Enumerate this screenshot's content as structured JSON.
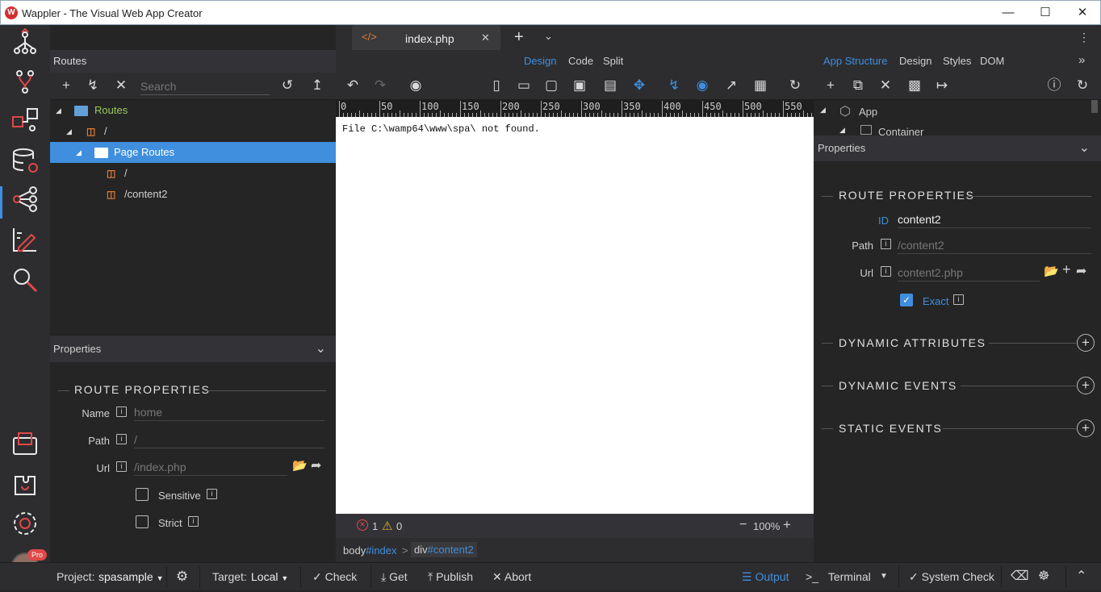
{
  "window": {
    "title": "Wappler - The Visual Web App Creator",
    "logo": "W"
  },
  "tab": {
    "file": "index.php"
  },
  "left": {
    "header": "Routes",
    "search_placeholder": "Search",
    "tree": [
      {
        "label": "Routes",
        "type": "folder-root"
      },
      {
        "label": "/",
        "type": "page"
      },
      {
        "label": "Page Routes",
        "type": "folder",
        "selected": true
      },
      {
        "label": "/",
        "type": "page"
      },
      {
        "label": "/content2",
        "type": "page"
      }
    ],
    "properties_header": "Properties",
    "section_title": "ROUTE PROPERTIES",
    "name_label": "Name",
    "name_placeholder": "home",
    "path_label": "Path",
    "path_placeholder": "/",
    "url_label": "Url",
    "url_placeholder": "/index.php",
    "sensitive_label": "Sensitive",
    "strict_label": "Strict"
  },
  "modes": {
    "design": "Design",
    "code": "Code",
    "split": "Split"
  },
  "ruler_ticks": [
    "0",
    "50",
    "100",
    "150",
    "200",
    "250",
    "300",
    "350",
    "400",
    "450",
    "500",
    "550"
  ],
  "canvas": {
    "message": "File C:\\wamp64\\www\\spa\\ not found."
  },
  "status": {
    "errors": "1",
    "warnings": "0",
    "zoom": "100%"
  },
  "breadcrumb": {
    "first_tag": "body",
    "first_id": "#index",
    "sep": ">",
    "second_tag": "div",
    "second_id": "#content2"
  },
  "right": {
    "tabs": {
      "app_structure": "App Structure",
      "design": "Design",
      "styles": "Styles",
      "dom": "DOM"
    },
    "tree": {
      "app": "App",
      "container": "Container"
    },
    "properties_header": "Properties",
    "section_title": "ROUTE PROPERTIES",
    "id_label": "ID",
    "id_value": "content2",
    "path_label": "Path",
    "path_placeholder": "/content2",
    "url_label": "Url",
    "url_placeholder": "content2.php",
    "exact_label": "Exact",
    "dynamic_attributes": "DYNAMIC ATTRIBUTES",
    "dynamic_events": "DYNAMIC EVENTS",
    "static_events": "STATIC EVENTS"
  },
  "bottom": {
    "project_label": "Project:",
    "project_value": "spasample",
    "target_label": "Target:",
    "target_value": "Local",
    "check": "Check",
    "get": "Get",
    "publish": "Publish",
    "abort": "Abort",
    "output": "Output",
    "terminal": "Terminal",
    "system_check": "System Check",
    "pro_badge": "Pro"
  },
  "colors": {
    "accent": "#3f8fde",
    "html5": "#e07a36",
    "error": "#e04848",
    "warning": "#e8b030"
  }
}
